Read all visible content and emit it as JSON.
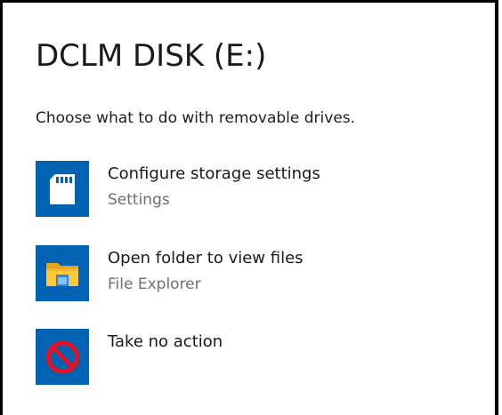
{
  "dialog": {
    "title": "DCLM DISK (E:)",
    "subtitle": "Choose what to do with removable drives.",
    "accent_color": "#0063b1",
    "options": [
      {
        "label": "Configure storage settings",
        "sublabel": "Settings",
        "icon": "sd-card-icon"
      },
      {
        "label": "Open folder to view files",
        "sublabel": "File Explorer",
        "icon": "folder-icon"
      },
      {
        "label": "Take no action",
        "sublabel": "",
        "icon": "no-action-icon"
      }
    ]
  }
}
